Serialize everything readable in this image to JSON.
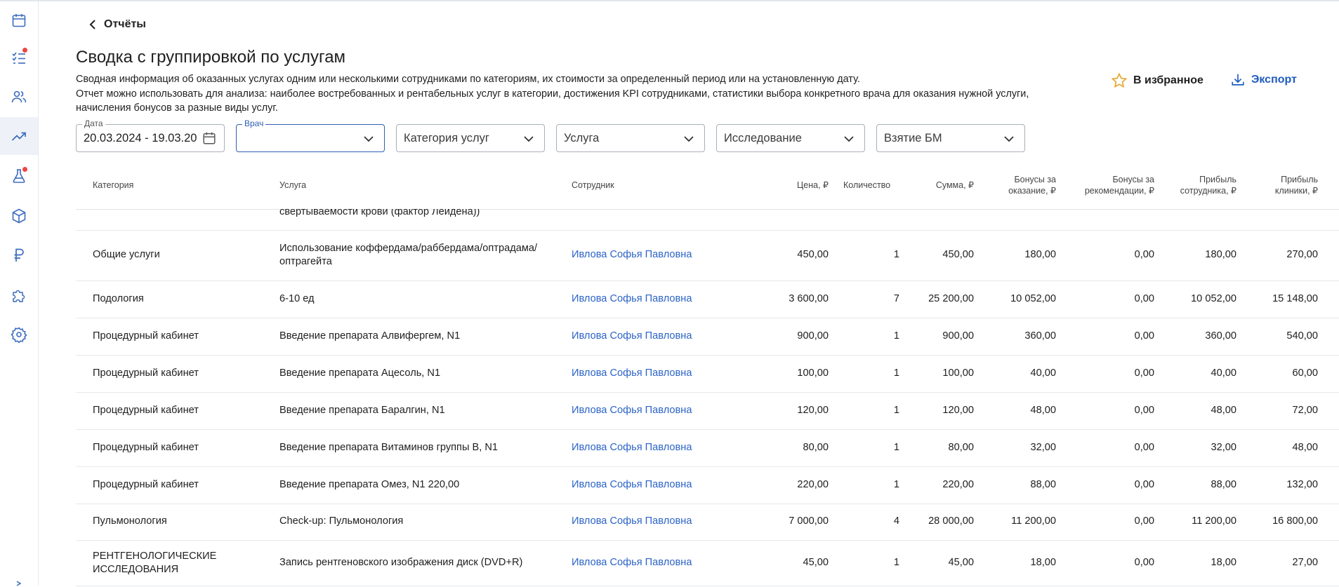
{
  "nav": {
    "back_label": "Отчёты"
  },
  "page": {
    "title": "Сводка с группировкой по услугам",
    "description_1": "Сводная информация об оказанных услугах одним или несколькими сотрудниками по категориям, их стоимости за определенный период или на установленную дату.",
    "description_2": "Отчет можно использовать для анализа: наиболее востребованных и рентабельных услуг в категории, достижения KPI сотрудниками, статистики выбора конкретного врача для оказания нужной услуги,",
    "description_3": "начисления бонусов за разные виды услуг."
  },
  "actions": {
    "favorite_label": "В избранное",
    "export_label": "Экспорт"
  },
  "filters": {
    "date_label": "Дата",
    "date_value": "20.03.2024 - 19.03.2025",
    "doctor_label": "Врач",
    "doctor_value": "",
    "category_placeholder": "Категория услуг",
    "service_placeholder": "Услуга",
    "research_placeholder": "Исследование",
    "bm_placeholder": "Взятие БМ"
  },
  "table": {
    "headers": {
      "category": "Категория",
      "service": "Услуга",
      "employee": "Сотрудник",
      "price": "Цена, ₽",
      "quantity": "Количество",
      "sum": "Сумма, ₽",
      "bonus_service_1": "Бонусы за",
      "bonus_service_2": "оказание, ₽",
      "bonus_rec_1": "Бонусы за",
      "bonus_rec_2": "рекомендации, ₽",
      "profit_emp_1": "Прибыль",
      "profit_emp_2": "сотрудника, ₽",
      "profit_clinic_1": "Прибыль",
      "profit_clinic_2": "клиники, ₽"
    },
    "partial_row_text": "свертываемости крови (фактор Лейдена))",
    "rows": [
      {
        "category_1": "Общие услуги",
        "category_2": "",
        "service_1": "Использование коффердама/раббердама/оптрадама/",
        "service_2": "оптрагейта",
        "employee": "Ивлова Софья Павловна",
        "price": "450,00",
        "qty": "1",
        "sum": "450,00",
        "bonus": "180,00",
        "rec": "0,00",
        "profit_emp": "180,00",
        "profit_clinic": "270,00"
      },
      {
        "category_1": "Подология",
        "category_2": "",
        "service_1": "6-10 ед",
        "service_2": "",
        "employee": "Ивлова Софья Павловна",
        "price": "3 600,00",
        "qty": "7",
        "sum": "25 200,00",
        "bonus": "10 052,00",
        "rec": "0,00",
        "profit_emp": "10 052,00",
        "profit_clinic": "15 148,00"
      },
      {
        "category_1": "Процедурный кабинет",
        "category_2": "",
        "service_1": "Введение препарата Алвифергем, N1",
        "service_2": "",
        "employee": "Ивлова Софья Павловна",
        "price": "900,00",
        "qty": "1",
        "sum": "900,00",
        "bonus": "360,00",
        "rec": "0,00",
        "profit_emp": "360,00",
        "profit_clinic": "540,00"
      },
      {
        "category_1": "Процедурный кабинет",
        "category_2": "",
        "service_1": "Введение препарата Ацесоль, N1",
        "service_2": "",
        "employee": "Ивлова Софья Павловна",
        "price": "100,00",
        "qty": "1",
        "sum": "100,00",
        "bonus": "40,00",
        "rec": "0,00",
        "profit_emp": "40,00",
        "profit_clinic": "60,00"
      },
      {
        "category_1": "Процедурный кабинет",
        "category_2": "",
        "service_1": "Введение препарата Баралгин, N1",
        "service_2": "",
        "employee": "Ивлова Софья Павловна",
        "price": "120,00",
        "qty": "1",
        "sum": "120,00",
        "bonus": "48,00",
        "rec": "0,00",
        "profit_emp": "48,00",
        "profit_clinic": "72,00"
      },
      {
        "category_1": "Процедурный кабинет",
        "category_2": "",
        "service_1": "Введение препарата Витаминов группы В, N1",
        "service_2": "",
        "employee": "Ивлова Софья Павловна",
        "price": "80,00",
        "qty": "1",
        "sum": "80,00",
        "bonus": "32,00",
        "rec": "0,00",
        "profit_emp": "32,00",
        "profit_clinic": "48,00"
      },
      {
        "category_1": "Процедурный кабинет",
        "category_2": "",
        "service_1": "Введение препарата Омез, N1 220,00",
        "service_2": "",
        "employee": "Ивлова Софья Павловна",
        "price": "220,00",
        "qty": "1",
        "sum": "220,00",
        "bonus": "88,00",
        "rec": "0,00",
        "profit_emp": "88,00",
        "profit_clinic": "132,00"
      },
      {
        "category_1": "Пульмонология",
        "category_2": "",
        "service_1": "Check-up: Пульмонология",
        "service_2": "",
        "employee": "Ивлова Софья Павловна",
        "price": "7 000,00",
        "qty": "4",
        "sum": "28 000,00",
        "bonus": "11 200,00",
        "rec": "0,00",
        "profit_emp": "11 200,00",
        "profit_clinic": "16 800,00"
      },
      {
        "category_1": "РЕНТГЕНОЛОГИЧЕСКИЕ",
        "category_2": "ИССЛЕДОВАНИЯ",
        "service_1": "Запись рентгеновского изображения диск (DVD+R)",
        "service_2": "",
        "employee": "Ивлова Софья Павловна",
        "price": "45,00",
        "qty": "1",
        "sum": "45,00",
        "bonus": "18,00",
        "rec": "0,00",
        "profit_emp": "18,00",
        "profit_clinic": "27,00"
      }
    ]
  },
  "colors": {
    "accent": "#2b63c6",
    "active_nav_bg": "#eef2f8",
    "notification_dot": "#ef4444",
    "favorite_star": "#e5a82e"
  },
  "sidebar_icons": [
    "calendar-icon",
    "tasks-icon",
    "users-icon",
    "reports-icon",
    "lab-icon",
    "box-icon",
    "ruble-icon",
    "puzzle-icon",
    "settings-icon"
  ]
}
